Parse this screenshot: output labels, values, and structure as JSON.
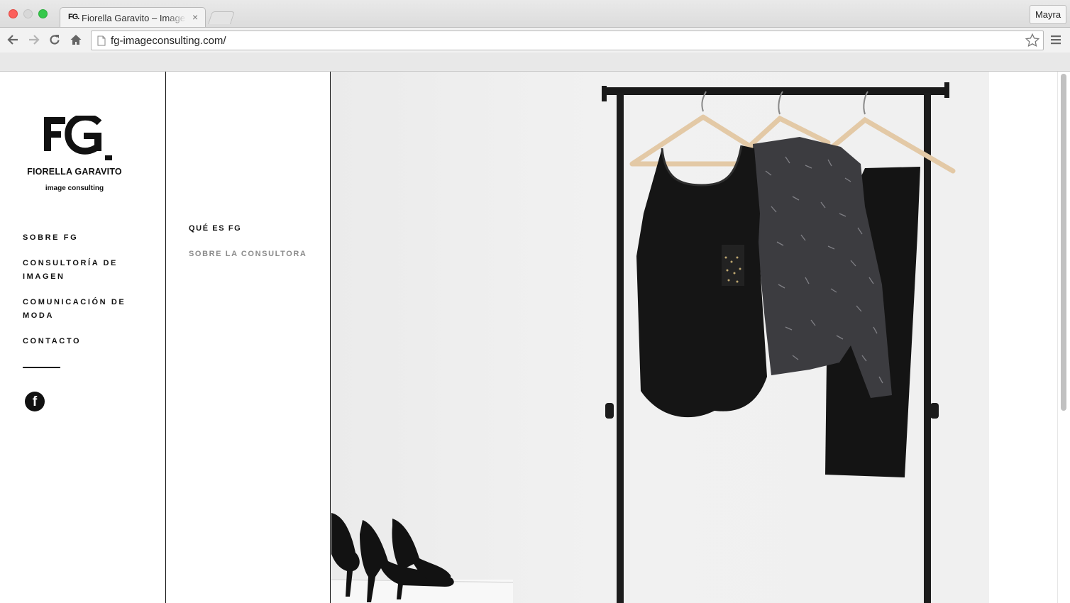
{
  "browser": {
    "tab": {
      "favicon_text": "FG.",
      "title": "Fiorella Garavito – Image Consulting",
      "close_glyph": "×"
    },
    "profile_name": "Mayra",
    "url": "fg-imageconsulting.com/",
    "icons": [
      "back-icon",
      "forward-icon",
      "reload-icon",
      "home-icon",
      "page-icon",
      "star-icon",
      "menu-icon"
    ],
    "traffic_lights": {
      "close": "#fc605c",
      "minimize": "#d8d8d8",
      "zoom": "#34c84a"
    }
  },
  "site": {
    "logo": {
      "mark": "FG.",
      "name": "FIORELLA GARAVITO",
      "tagline": "image consulting"
    },
    "nav": [
      {
        "label": "SOBRE FG"
      },
      {
        "label": "CONSULTORÍA DE IMAGEN"
      },
      {
        "label": "COMUNICACIÓN DE MODA"
      },
      {
        "label": "CONTACTO"
      }
    ],
    "social": {
      "facebook_glyph": "f"
    },
    "subnav": [
      {
        "label": "QUÉ ES FG",
        "state": "active"
      },
      {
        "label": "SOBRE LA CONSULTORA",
        "state": "inactive"
      }
    ],
    "hero": {
      "subject": "clothing-rack-with-black-garments-and-heels"
    }
  },
  "colors": {
    "text": "#111111",
    "muted_nav": "#8a8a8a",
    "hero_bg": "#f0f0f0"
  }
}
